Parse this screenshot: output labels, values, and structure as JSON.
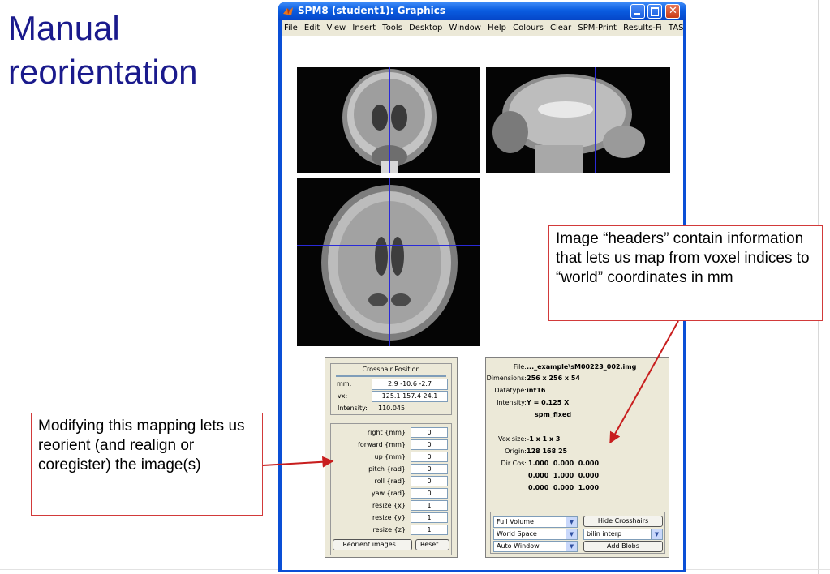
{
  "slide": {
    "title": "Manual reorientation"
  },
  "window": {
    "title": "SPM8 (student1): Graphics",
    "controls": [
      "minimize",
      "maximize",
      "close"
    ]
  },
  "menubar": {
    "items": [
      "File",
      "Edit",
      "View",
      "Insert",
      "Tools",
      "Desktop",
      "Window",
      "Help",
      "Colours",
      "Clear",
      "SPM-Print",
      "Results-Fi",
      "TASKS"
    ],
    "overflow": "»"
  },
  "crosshair_panel": {
    "title": "Crosshair Position",
    "mm_label": "mm:",
    "mm_value": "2.9 -10.6 -2.7",
    "vx_label": "vx:",
    "vx_value": "125.1 157.4 24.1",
    "intensity_label": "Intensity:",
    "intensity_value": "110.045"
  },
  "reorient_panel": {
    "params": [
      {
        "label": "right  {mm}",
        "value": "0"
      },
      {
        "label": "forward  {mm}",
        "value": "0"
      },
      {
        "label": "up  {mm}",
        "value": "0"
      },
      {
        "label": "pitch  {rad}",
        "value": "0"
      },
      {
        "label": "roll  {rad}",
        "value": "0"
      },
      {
        "label": "yaw  {rad}",
        "value": "0"
      },
      {
        "label": "resize  {x}",
        "value": "1"
      },
      {
        "label": "resize  {y}",
        "value": "1"
      },
      {
        "label": "resize  {z}",
        "value": "1"
      }
    ],
    "reorient_button": "Reorient images...",
    "reset_button": "Reset..."
  },
  "info_panel": {
    "file_label": "File:",
    "file_value": "..._example\\sM00223_002.img",
    "dimensions_label": "Dimensions:",
    "dimensions_value": "256 x 256 x 54",
    "datatype_label": "Datatype:",
    "datatype_value": "int16",
    "intensity_label": "Intensity:",
    "intensity_value": "Y = 0.125 X",
    "intensity_note": "spm_fixed",
    "voxsize_label": "Vox size:",
    "voxsize_value": "-1 x 1 x 3",
    "origin_label": "Origin:",
    "origin_value": "128 168 25",
    "dircos_label": "Dir Cos:",
    "dircos_rows": [
      "1.000  0.000  0.000",
      "0.000  1.000  0.000",
      "0.000  0.000  1.000"
    ]
  },
  "view_controls": {
    "volume_select": "Full Volume",
    "space_select": "World Space",
    "window_select": "Auto Window",
    "interp_select": "bilin interp",
    "hide_crosshairs": "Hide Crosshairs",
    "add_blobs": "Add Blobs"
  },
  "callouts": {
    "headers": "Image “headers” contain information that lets us map from voxel indices to “world” coordinates in mm",
    "mapping": "Modifying this mapping lets us reorient (and realign or coregister) the image(s)"
  },
  "colors": {
    "title": "#1a1a8c",
    "crosshair": "#2a2ad8",
    "callout_border": "#d23a3a",
    "arrow": "#c81e1e",
    "xp_blue": "#0a4fd6",
    "panel_bg": "#ece9d8"
  }
}
